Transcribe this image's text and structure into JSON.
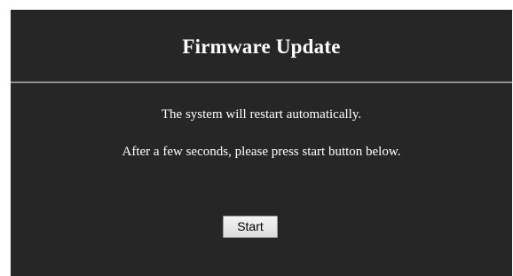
{
  "dialog": {
    "title": "Firmware Update",
    "messages": [
      "The system will restart automatically.",
      "After a few seconds, please press start button below."
    ],
    "start_label": "Start"
  },
  "colors": {
    "background": "#262626",
    "text": "#ffffff",
    "divider": "#c8c8c8",
    "button_bg": "#e8e8e8"
  }
}
